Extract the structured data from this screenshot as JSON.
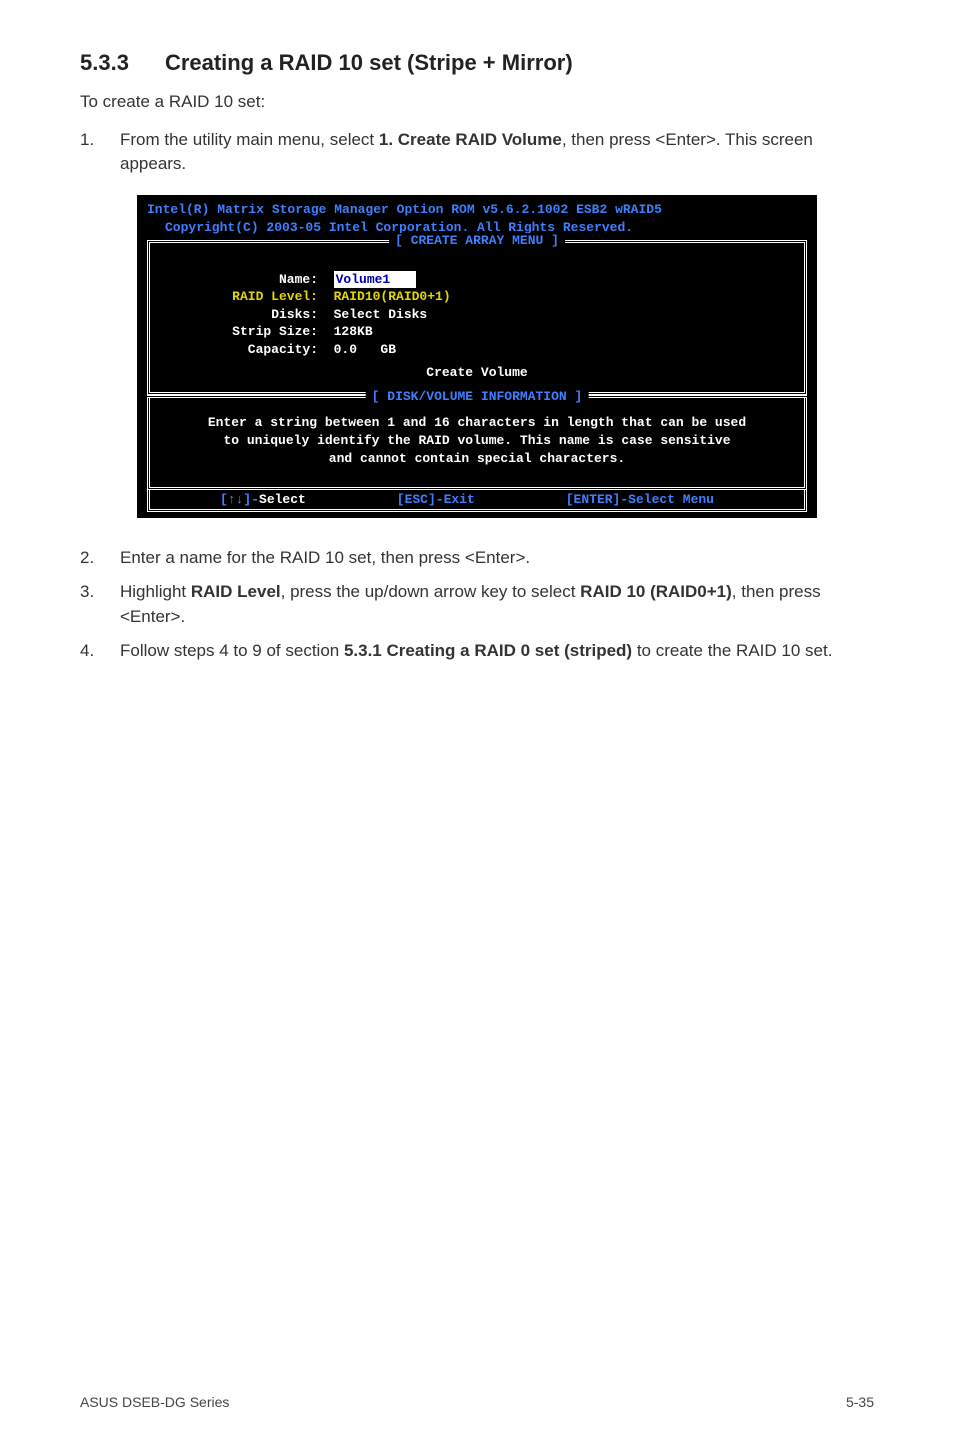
{
  "heading": {
    "number": "5.3.3",
    "title": "Creating a RAID 10 set (Stripe + Mirror)"
  },
  "intro": "To create a RAID 10 set:",
  "step1": {
    "num": "1.",
    "pre": "From the utility main menu, select ",
    "bold": "1. Create RAID Volume",
    "post": ", then press <Enter>. This screen appears."
  },
  "terminal": {
    "header1": "Intel(R) Matrix Storage Manager Option ROM v5.6.2.1002 ESB2 wRAID5",
    "header2": "Copyright(C) 2003-05 Intel Corporation. All Rights Reserved.",
    "array_menu_title": "[ CREATE ARRAY MENU ]",
    "fields": {
      "name_label": "Name:",
      "name_value": "Volume1",
      "raid_label": "RAID Level:",
      "raid_value": "RAID10(RAID0+1)",
      "disks_label": "Disks:",
      "disks_value": "Select Disks",
      "strip_label": "Strip Size:",
      "strip_value": "128KB",
      "capacity_label": "Capacity:",
      "capacity_value": "0.0   GB"
    },
    "create_volume": "Create Volume",
    "info_title": "[ DISK/VOLUME INFORMATION ]",
    "info_line1": "Enter a string between 1 and 16 characters in length that can be used",
    "info_line2": "to uniquely identify the RAID volume. This name is case sensitive",
    "info_line3": "and cannot contain special characters.",
    "hint_select_label": "[↑↓]-",
    "hint_select_word": "Select",
    "hint_esc": "[ESC]-Exit",
    "hint_enter": "[ENTER]-Select Menu"
  },
  "step2": {
    "num": "2.",
    "text": "Enter a name for the RAID 10  set, then press <Enter>."
  },
  "step3": {
    "num": "3.",
    "pre": "Highlight ",
    "bold1": "RAID Level",
    "mid": ", press the up/down arrow key to select ",
    "bold2": "RAID 10 (RAID0+1)",
    "post": ", then press <Enter>."
  },
  "step4": {
    "num": "4.",
    "pre": "Follow steps 4 to 9 of section ",
    "bold": "5.3.1 Creating a RAID 0 set (striped)",
    "post": " to create the RAID 10 set."
  },
  "footer": {
    "left": "ASUS DSEB-DG Series",
    "right": "5-35"
  }
}
